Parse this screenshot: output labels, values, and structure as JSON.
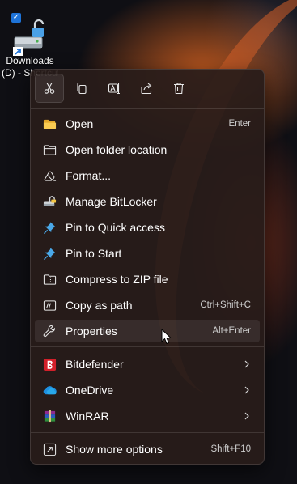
{
  "desktop": {
    "icon_label_line1": "Downloads",
    "icon_label_line2": "(D) - Shortcut",
    "icon": "drive-shortcut-icon"
  },
  "toolbar": [
    {
      "name": "cut",
      "icon": "scissors-icon"
    },
    {
      "name": "copy",
      "icon": "copy-icon"
    },
    {
      "name": "rename",
      "icon": "rename-icon"
    },
    {
      "name": "share",
      "icon": "share-icon"
    },
    {
      "name": "delete",
      "icon": "trash-icon"
    }
  ],
  "menu": {
    "items": [
      {
        "label": "Open",
        "shortcut": "Enter",
        "icon": "folder-open-icon"
      },
      {
        "label": "Open folder location",
        "shortcut": "",
        "icon": "folder-outline-icon"
      },
      {
        "label": "Format...",
        "shortcut": "",
        "icon": "format-icon"
      },
      {
        "label": "Manage BitLocker",
        "shortcut": "",
        "icon": "bitlocker-key-icon"
      },
      {
        "label": "Pin to Quick access",
        "shortcut": "",
        "icon": "pin-icon"
      },
      {
        "label": "Pin to Start",
        "shortcut": "",
        "icon": "pin-icon"
      },
      {
        "label": "Compress to ZIP file",
        "shortcut": "",
        "icon": "zip-folder-icon"
      },
      {
        "label": "Copy as path",
        "shortcut": "Ctrl+Shift+C",
        "icon": "copy-path-icon"
      },
      {
        "label": "Properties",
        "shortcut": "Alt+Enter",
        "icon": "wrench-icon"
      }
    ],
    "submenus": [
      {
        "label": "Bitdefender",
        "icon": "bitdefender-icon"
      },
      {
        "label": "OneDrive",
        "icon": "onedrive-cloud-icon"
      },
      {
        "label": "WinRAR",
        "icon": "winrar-icon"
      }
    ],
    "more": {
      "label": "Show more options",
      "shortcut": "Shift+F10",
      "icon": "show-more-icon"
    }
  },
  "colors": {
    "accent": "#4cc2ff",
    "bitdefender": "#d3202a",
    "onedrive": "#1e8fe0"
  }
}
